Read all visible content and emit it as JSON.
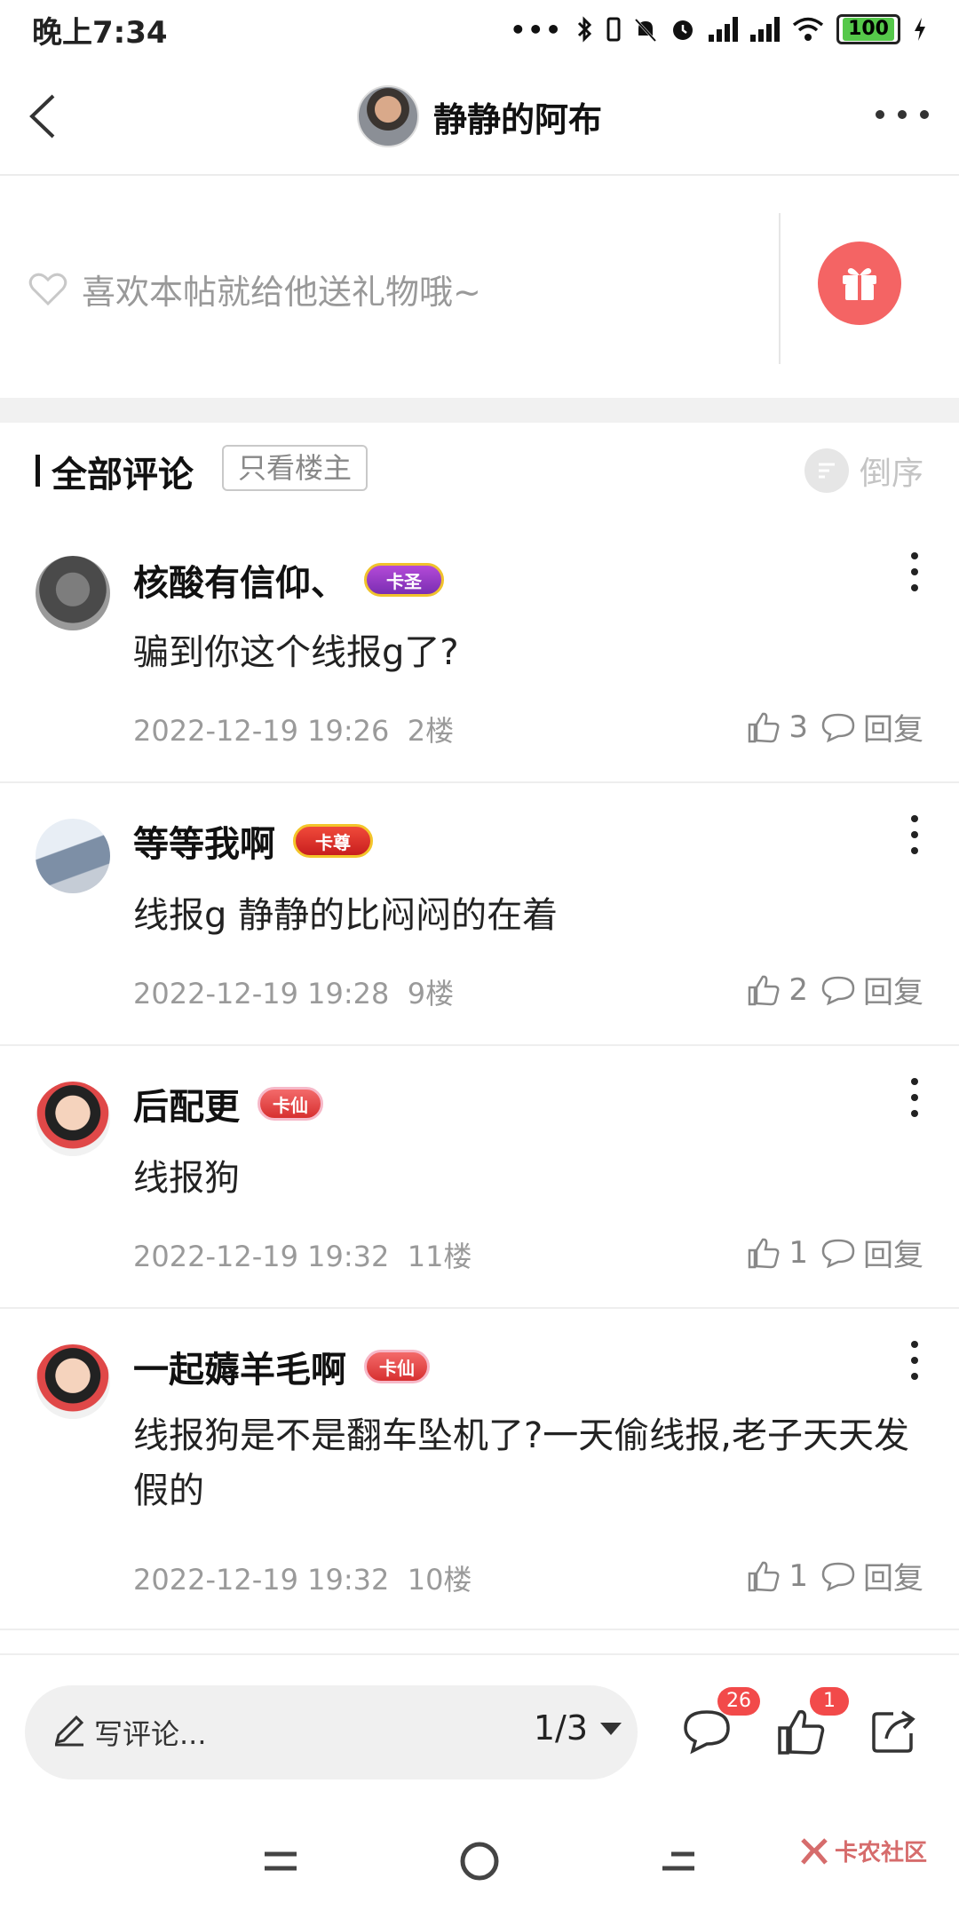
{
  "status_bar": {
    "time": "晚上7:34",
    "battery": "100"
  },
  "nav": {
    "title": "静静的阿布"
  },
  "gift": {
    "hint": "喜欢本帖就给他送礼物哦~"
  },
  "comments_header": {
    "title": "全部评论",
    "filter_label": "只看楼主",
    "sort_label": "倒序"
  },
  "comments": [
    {
      "name": "核酸有信仰、",
      "badge": "卡圣",
      "text": "骗到你这个线报g了?",
      "time": "2022-12-19 19:26",
      "floor": "2楼",
      "likes": "3",
      "reply": "回复"
    },
    {
      "name": "等等我啊",
      "badge": "卡尊",
      "text": "线报g 静静的比闷闷的在着",
      "time": "2022-12-19 19:28",
      "floor": "9楼",
      "likes": "2",
      "reply": "回复"
    },
    {
      "name": "后配更",
      "badge": "卡仙",
      "text": "线报狗",
      "time": "2022-12-19 19:32",
      "floor": "11楼",
      "likes": "1",
      "reply": "回复"
    },
    {
      "name": "一起薅羊毛啊",
      "badge": "卡仙",
      "text": "线报狗是不是翻车坠机了?一天偷线报,老子天天发假的",
      "time": "2022-12-19 19:32",
      "floor": "10楼",
      "likes": "1",
      "reply": "回复"
    }
  ],
  "toolbar": {
    "write_label": "写评论...",
    "page": "1/3",
    "comment_count": "26",
    "like_count": "1"
  },
  "watermark": {
    "text": "卡农社区"
  },
  "colors": {
    "accent_red": "#f46464",
    "badge_red": "#f24a4a"
  }
}
